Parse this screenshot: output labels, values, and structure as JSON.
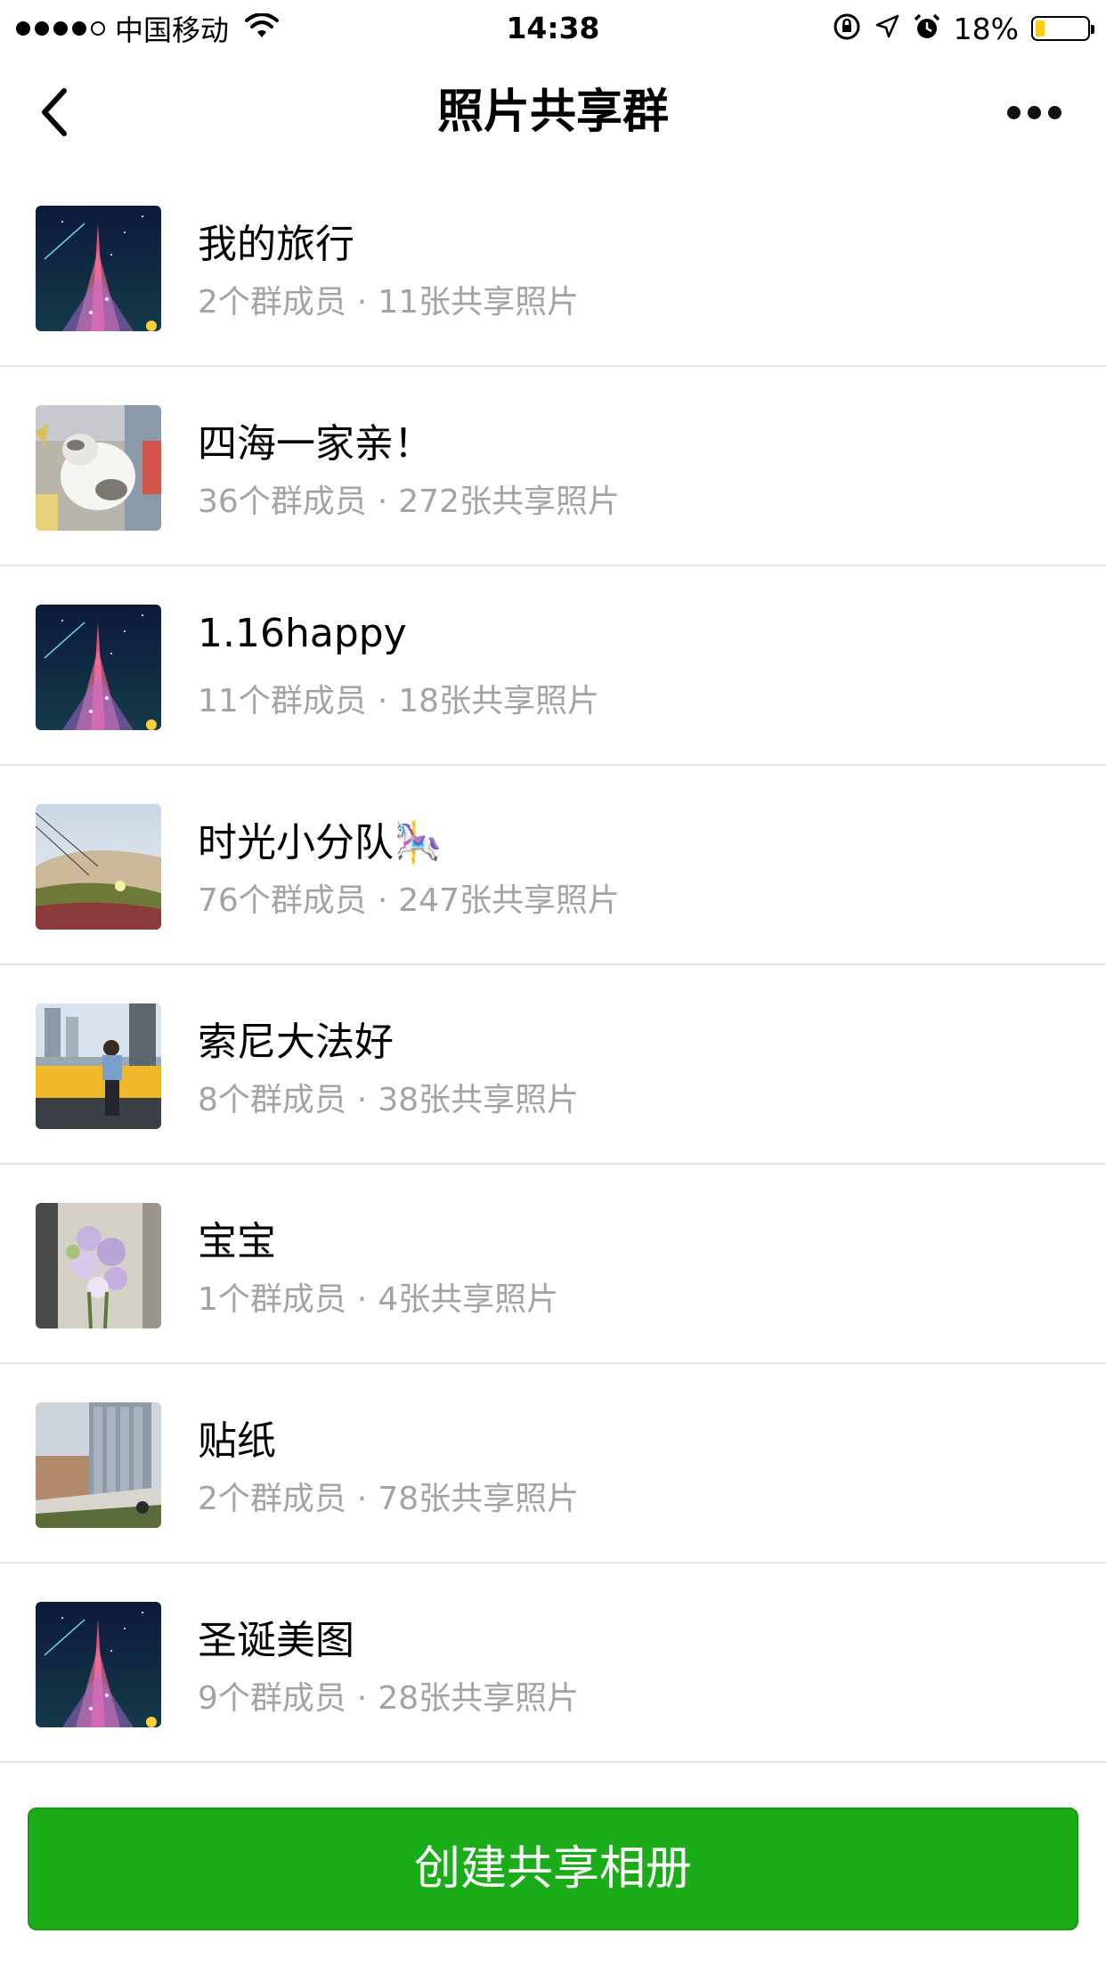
{
  "status_bar": {
    "carrier": "中国移动",
    "time": "14:38",
    "battery_percent": "18%",
    "battery_level": 0.18,
    "signal_bars": 4,
    "icons": [
      "wifi-icon",
      "orientation-lock-icon",
      "location-arrow-icon",
      "alarm-icon",
      "battery-icon"
    ]
  },
  "nav": {
    "title": "照片共享群",
    "back_icon": "chevron-left-icon",
    "more_icon": "more-dots-icon"
  },
  "albums": [
    {
      "name": "我的旅行",
      "members": "2个群成员",
      "photos": "11张共享照片",
      "thumb": "eiffel-tower"
    },
    {
      "name": "四海一家亲！",
      "members": "36个群成员",
      "photos": "272张共享照片",
      "thumb": "cat"
    },
    {
      "name": "1.16happy",
      "members": "11个群成员",
      "photos": "18张共享照片",
      "thumb": "eiffel-tower"
    },
    {
      "name": "时光小分队🎠",
      "members": "76个群成员",
      "photos": "247张共享照片",
      "thumb": "flowers-field"
    },
    {
      "name": "索尼大法好",
      "members": "8个群成员",
      "photos": "38张共享照片",
      "thumb": "person-bench"
    },
    {
      "name": "宝宝",
      "members": "1个群成员",
      "photos": "4张共享照片",
      "thumb": "lilac-flowers"
    },
    {
      "name": "贴纸",
      "members": "2个群成员",
      "photos": "78张共享照片",
      "thumb": "buildings"
    },
    {
      "name": "圣诞美图",
      "members": "9个群成员",
      "photos": "28张共享照片",
      "thumb": "eiffel-tower"
    }
  ],
  "separator": "·",
  "create_button": "创建共享相册",
  "colors": {
    "accent": "#1aad19",
    "subtitle": "#a3a3a3",
    "battery": "#ffcc00"
  }
}
